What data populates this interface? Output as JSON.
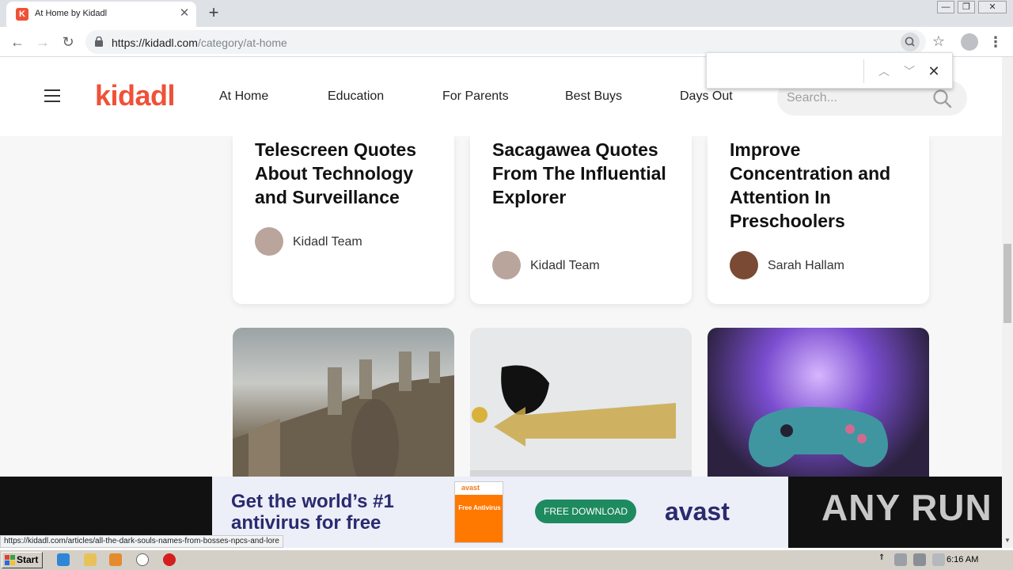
{
  "tab": {
    "title": "At Home by Kidadl",
    "favicon_letter": "K"
  },
  "window_controls": {
    "minimize": "—",
    "maximize": "❐",
    "close": "✕"
  },
  "toolbar": {
    "url_host": "https://kidadl.com",
    "url_path": "/category/at-home"
  },
  "site": {
    "logo": "kidadl",
    "nav": [
      "At Home",
      "Education",
      "For Parents",
      "Best Buys",
      "Days Out"
    ],
    "search_placeholder": "Search..."
  },
  "cards": [
    {
      "title": "Telescreen Quotes About Technology and Surveillance",
      "author": "Kidadl Team"
    },
    {
      "title": "Sacagawea Quotes From The Influential Explorer",
      "author": "Kidadl Team"
    },
    {
      "title": "Improve Concentration and Attention In Preschoolers",
      "author": "Sarah Hallam"
    }
  ],
  "ad": {
    "headline": "Get the world’s #1 antivirus for free",
    "box_brand": "avast",
    "box_text": "Free Antivirus",
    "cta": "FREE DOWNLOAD",
    "logo": "avast"
  },
  "watermark": "ANY RUN",
  "status_url": "https://kidadl.com/articles/all-the-dark-souls-names-from-bosses-npcs-and-lore",
  "taskbar": {
    "start": "Start",
    "clock": "6:16 AM"
  }
}
